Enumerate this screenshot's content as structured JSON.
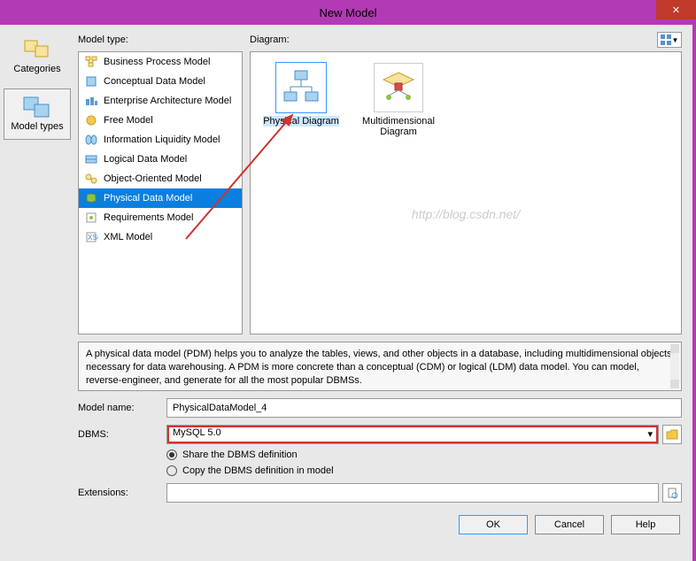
{
  "window": {
    "title": "New Model",
    "close": "✕"
  },
  "leftNav": {
    "categories_label": "Categories",
    "model_types_label": "Model types"
  },
  "headers": {
    "model_type": "Model type:",
    "diagram": "Diagram:"
  },
  "modelTypes": [
    {
      "label": "Business Process Model"
    },
    {
      "label": "Conceptual Data Model"
    },
    {
      "label": "Enterprise Architecture Model"
    },
    {
      "label": "Free Model"
    },
    {
      "label": "Information Liquidity Model"
    },
    {
      "label": "Logical Data Model"
    },
    {
      "label": "Object-Oriented Model"
    },
    {
      "label": "Physical Data Model"
    },
    {
      "label": "Requirements Model"
    },
    {
      "label": "XML Model"
    }
  ],
  "diagrams": [
    {
      "label": "Physical Diagram"
    },
    {
      "label": "Multidimensional Diagram"
    }
  ],
  "watermark": "http://blog.csdn.net/",
  "description": "A physical data model (PDM) helps you to analyze the tables, views, and other objects in a database, including multidimensional objects necessary for data warehousing. A PDM is more concrete than a conceptual (CDM) or logical (LDM) data model. You can model, reverse-engineer, and generate for all the most popular DBMSs.",
  "form": {
    "model_name_label": "Model name:",
    "model_name_value": "PhysicalDataModel_4",
    "dbms_label": "DBMS:",
    "dbms_value": "MySQL 5.0",
    "radio1": "Share the DBMS definition",
    "radio2": "Copy the DBMS definition in model",
    "extensions_label": "Extensions:"
  },
  "buttons": {
    "ok": "OK",
    "cancel": "Cancel",
    "help": "Help"
  }
}
